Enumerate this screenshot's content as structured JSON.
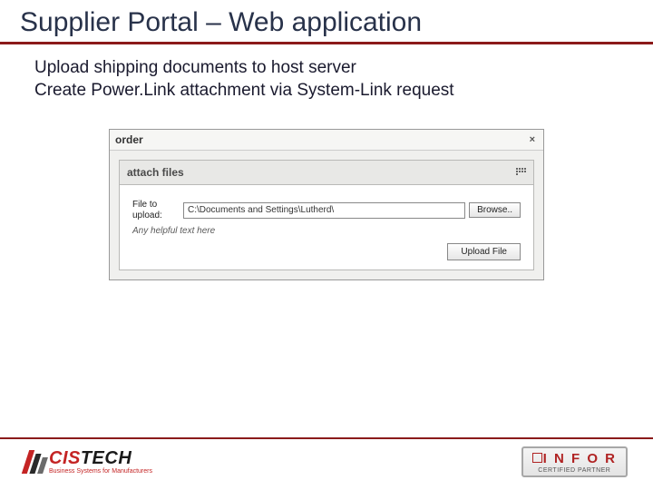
{
  "title": "Supplier Portal – Web application",
  "bullets": [
    "Upload shipping documents to host server",
    "Create Power.Link attachment via System-Link request"
  ],
  "app": {
    "window_title": "order",
    "close_glyph": "×",
    "panel_title": "attach files",
    "file_label": "File to\nupload:",
    "file_path": "C:\\Documents and Settings\\Lutherd\\",
    "browse_label": "Browse..",
    "hint": "Any helpful text here",
    "upload_label": "Upload File"
  },
  "footer": {
    "cistech": "CISTECH",
    "cistech_tag": "Business Systems for Manufacturers",
    "infor": "INFOR",
    "infor_sub": "CERTIFIED PARTNER"
  }
}
